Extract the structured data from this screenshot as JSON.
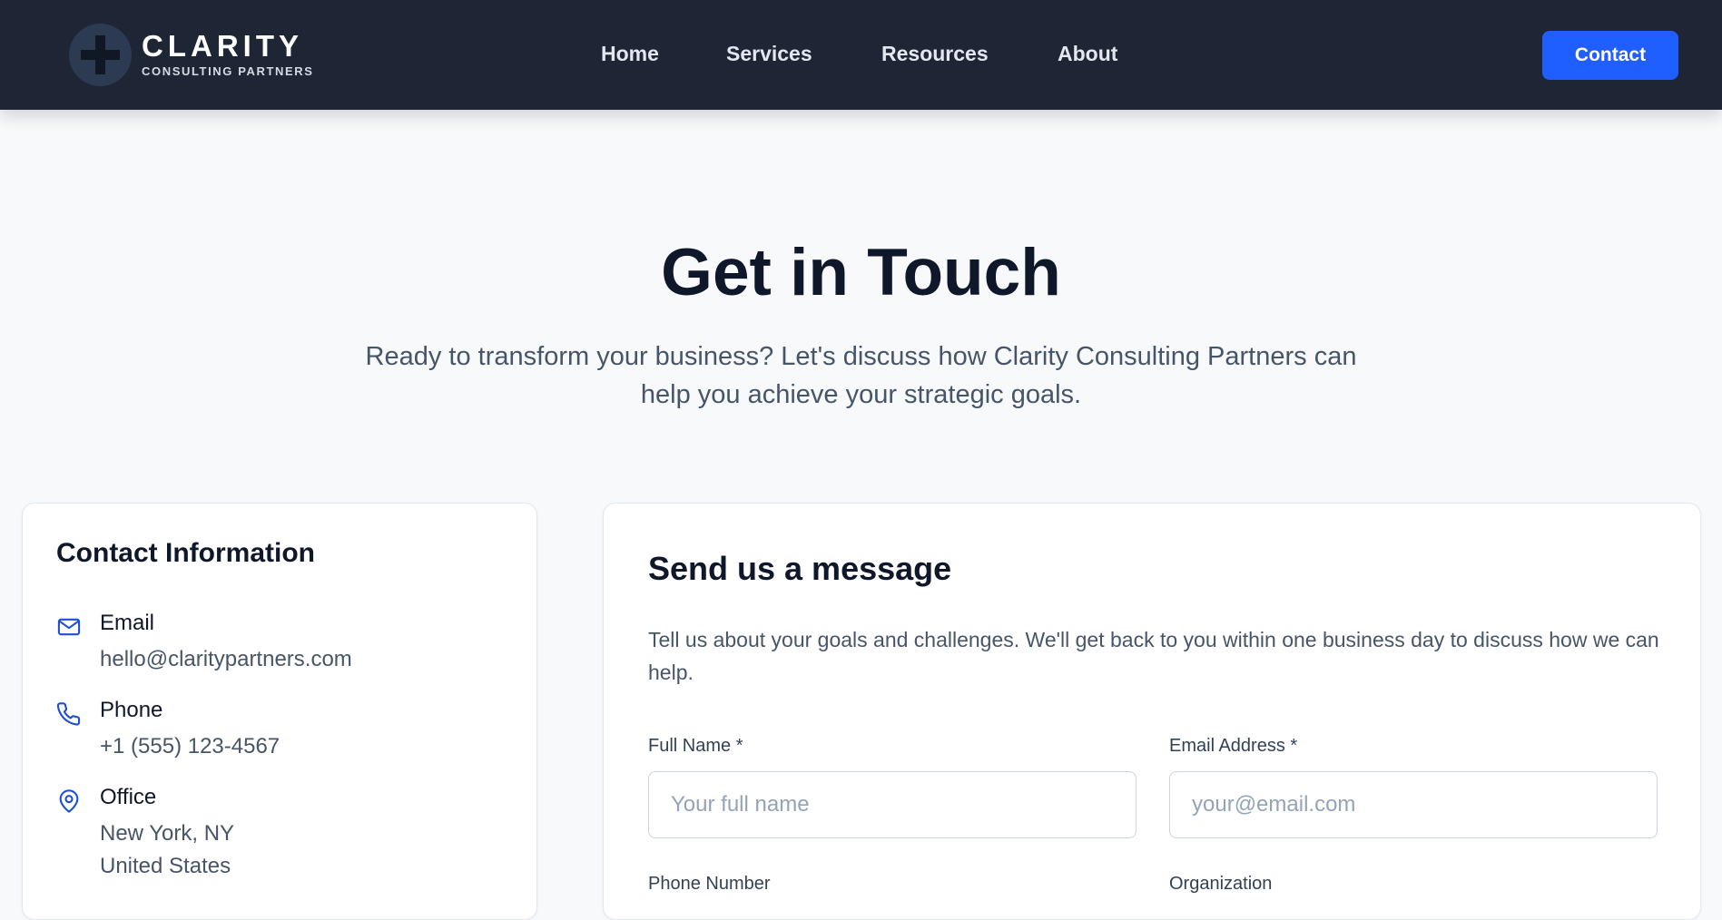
{
  "nav": {
    "logo_word": "CLARITY",
    "logo_sub": "CONSULTING PARTNERS",
    "links": [
      {
        "label": "Home"
      },
      {
        "label": "Services"
      },
      {
        "label": "Resources"
      },
      {
        "label": "About"
      }
    ],
    "cta_label": "Contact"
  },
  "hero": {
    "title": "Get in Touch",
    "subtitle": "Ready to transform your business? Let's discuss how Clarity Consulting Partners can help you achieve your strategic goals."
  },
  "contact_info": {
    "title": "Contact Information",
    "items": [
      {
        "icon": "mail-icon",
        "label": "Email",
        "value": "hello@claritypartners.com"
      },
      {
        "icon": "phone-icon",
        "label": "Phone",
        "value": "+1 (555) 123-4567"
      },
      {
        "icon": "map-pin-icon",
        "label": "Office",
        "value": "New York, NY",
        "value2": "United States"
      }
    ]
  },
  "form": {
    "title": "Send us a message",
    "description": "Tell us about your goals and challenges. We'll get back to you within one business day to discuss how we can help.",
    "fields": {
      "full_name": {
        "label": "Full Name *",
        "placeholder": "Your full name",
        "value": ""
      },
      "email": {
        "label": "Email Address *",
        "placeholder": "your@email.com",
        "value": ""
      },
      "phone": {
        "label": "Phone Number"
      },
      "organization": {
        "label": "Organization"
      }
    }
  },
  "colors": {
    "nav_bg": "#1e2535",
    "accent": "#1f5eff",
    "page_bg": "#f8f9fb",
    "icon_blue": "#1d4ed8"
  }
}
